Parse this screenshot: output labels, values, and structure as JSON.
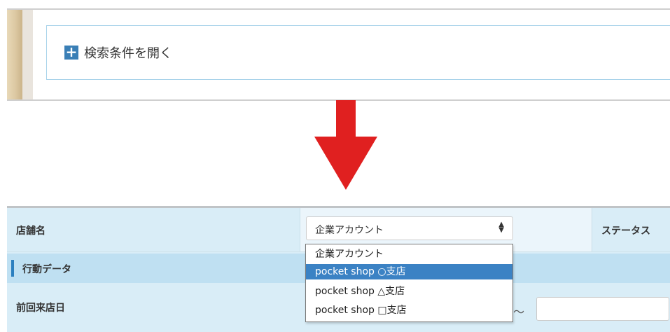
{
  "search_panel": {
    "toggle_icon": "plus-icon",
    "toggle_icon_glyph": "+",
    "toggle_label": "検索条件を開く"
  },
  "arrow": {
    "color": "#e02020",
    "icon": "arrow-down-icon"
  },
  "form": {
    "store_label": "店舗名",
    "store_select": {
      "selected": "企業アカウント",
      "arrow_glyph": "▲▼",
      "options": [
        "企業アカウント",
        "pocket shop ○支店",
        "pocket shop △支店",
        "pocket shop □支店"
      ],
      "highlighted_index": 1
    },
    "status_label": "ステータス",
    "section_title": "行動データ",
    "last_visit_label": "前回来店日",
    "range_separator": "～"
  },
  "colors": {
    "accent": "#3a7fb6",
    "form_bg": "#d9edf7",
    "section_bg": "#bfe0f2",
    "highlight": "#3b82c4"
  }
}
